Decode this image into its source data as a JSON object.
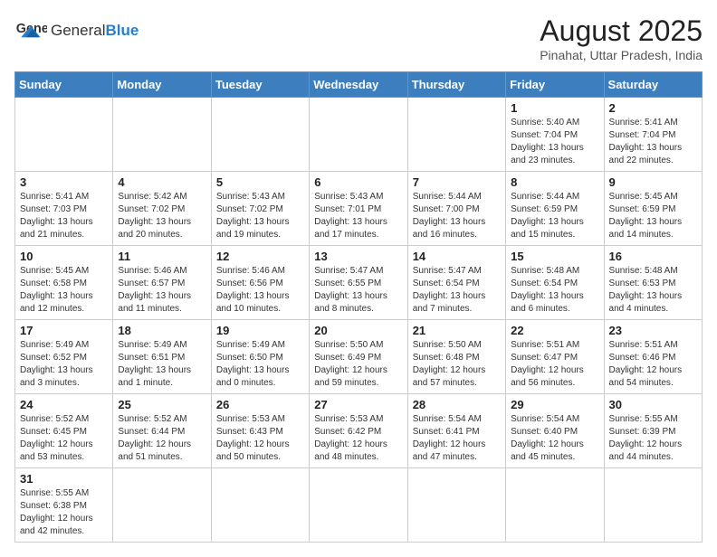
{
  "header": {
    "logo_text_general": "General",
    "logo_text_blue": "Blue",
    "title": "August 2025",
    "subtitle": "Pinahat, Uttar Pradesh, India"
  },
  "weekdays": [
    "Sunday",
    "Monday",
    "Tuesday",
    "Wednesday",
    "Thursday",
    "Friday",
    "Saturday"
  ],
  "weeks": [
    [
      {
        "day": "",
        "info": ""
      },
      {
        "day": "",
        "info": ""
      },
      {
        "day": "",
        "info": ""
      },
      {
        "day": "",
        "info": ""
      },
      {
        "day": "",
        "info": ""
      },
      {
        "day": "1",
        "info": "Sunrise: 5:40 AM\nSunset: 7:04 PM\nDaylight: 13 hours\nand 23 minutes."
      },
      {
        "day": "2",
        "info": "Sunrise: 5:41 AM\nSunset: 7:04 PM\nDaylight: 13 hours\nand 22 minutes."
      }
    ],
    [
      {
        "day": "3",
        "info": "Sunrise: 5:41 AM\nSunset: 7:03 PM\nDaylight: 13 hours\nand 21 minutes."
      },
      {
        "day": "4",
        "info": "Sunrise: 5:42 AM\nSunset: 7:02 PM\nDaylight: 13 hours\nand 20 minutes."
      },
      {
        "day": "5",
        "info": "Sunrise: 5:43 AM\nSunset: 7:02 PM\nDaylight: 13 hours\nand 19 minutes."
      },
      {
        "day": "6",
        "info": "Sunrise: 5:43 AM\nSunset: 7:01 PM\nDaylight: 13 hours\nand 17 minutes."
      },
      {
        "day": "7",
        "info": "Sunrise: 5:44 AM\nSunset: 7:00 PM\nDaylight: 13 hours\nand 16 minutes."
      },
      {
        "day": "8",
        "info": "Sunrise: 5:44 AM\nSunset: 6:59 PM\nDaylight: 13 hours\nand 15 minutes."
      },
      {
        "day": "9",
        "info": "Sunrise: 5:45 AM\nSunset: 6:59 PM\nDaylight: 13 hours\nand 14 minutes."
      }
    ],
    [
      {
        "day": "10",
        "info": "Sunrise: 5:45 AM\nSunset: 6:58 PM\nDaylight: 13 hours\nand 12 minutes."
      },
      {
        "day": "11",
        "info": "Sunrise: 5:46 AM\nSunset: 6:57 PM\nDaylight: 13 hours\nand 11 minutes."
      },
      {
        "day": "12",
        "info": "Sunrise: 5:46 AM\nSunset: 6:56 PM\nDaylight: 13 hours\nand 10 minutes."
      },
      {
        "day": "13",
        "info": "Sunrise: 5:47 AM\nSunset: 6:55 PM\nDaylight: 13 hours\nand 8 minutes."
      },
      {
        "day": "14",
        "info": "Sunrise: 5:47 AM\nSunset: 6:54 PM\nDaylight: 13 hours\nand 7 minutes."
      },
      {
        "day": "15",
        "info": "Sunrise: 5:48 AM\nSunset: 6:54 PM\nDaylight: 13 hours\nand 6 minutes."
      },
      {
        "day": "16",
        "info": "Sunrise: 5:48 AM\nSunset: 6:53 PM\nDaylight: 13 hours\nand 4 minutes."
      }
    ],
    [
      {
        "day": "17",
        "info": "Sunrise: 5:49 AM\nSunset: 6:52 PM\nDaylight: 13 hours\nand 3 minutes."
      },
      {
        "day": "18",
        "info": "Sunrise: 5:49 AM\nSunset: 6:51 PM\nDaylight: 13 hours\nand 1 minute."
      },
      {
        "day": "19",
        "info": "Sunrise: 5:49 AM\nSunset: 6:50 PM\nDaylight: 13 hours\nand 0 minutes."
      },
      {
        "day": "20",
        "info": "Sunrise: 5:50 AM\nSunset: 6:49 PM\nDaylight: 12 hours\nand 59 minutes."
      },
      {
        "day": "21",
        "info": "Sunrise: 5:50 AM\nSunset: 6:48 PM\nDaylight: 12 hours\nand 57 minutes."
      },
      {
        "day": "22",
        "info": "Sunrise: 5:51 AM\nSunset: 6:47 PM\nDaylight: 12 hours\nand 56 minutes."
      },
      {
        "day": "23",
        "info": "Sunrise: 5:51 AM\nSunset: 6:46 PM\nDaylight: 12 hours\nand 54 minutes."
      }
    ],
    [
      {
        "day": "24",
        "info": "Sunrise: 5:52 AM\nSunset: 6:45 PM\nDaylight: 12 hours\nand 53 minutes."
      },
      {
        "day": "25",
        "info": "Sunrise: 5:52 AM\nSunset: 6:44 PM\nDaylight: 12 hours\nand 51 minutes."
      },
      {
        "day": "26",
        "info": "Sunrise: 5:53 AM\nSunset: 6:43 PM\nDaylight: 12 hours\nand 50 minutes."
      },
      {
        "day": "27",
        "info": "Sunrise: 5:53 AM\nSunset: 6:42 PM\nDaylight: 12 hours\nand 48 minutes."
      },
      {
        "day": "28",
        "info": "Sunrise: 5:54 AM\nSunset: 6:41 PM\nDaylight: 12 hours\nand 47 minutes."
      },
      {
        "day": "29",
        "info": "Sunrise: 5:54 AM\nSunset: 6:40 PM\nDaylight: 12 hours\nand 45 minutes."
      },
      {
        "day": "30",
        "info": "Sunrise: 5:55 AM\nSunset: 6:39 PM\nDaylight: 12 hours\nand 44 minutes."
      }
    ],
    [
      {
        "day": "31",
        "info": "Sunrise: 5:55 AM\nSunset: 6:38 PM\nDaylight: 12 hours\nand 42 minutes."
      },
      {
        "day": "",
        "info": ""
      },
      {
        "day": "",
        "info": ""
      },
      {
        "day": "",
        "info": ""
      },
      {
        "day": "",
        "info": ""
      },
      {
        "day": "",
        "info": ""
      },
      {
        "day": "",
        "info": ""
      }
    ]
  ]
}
